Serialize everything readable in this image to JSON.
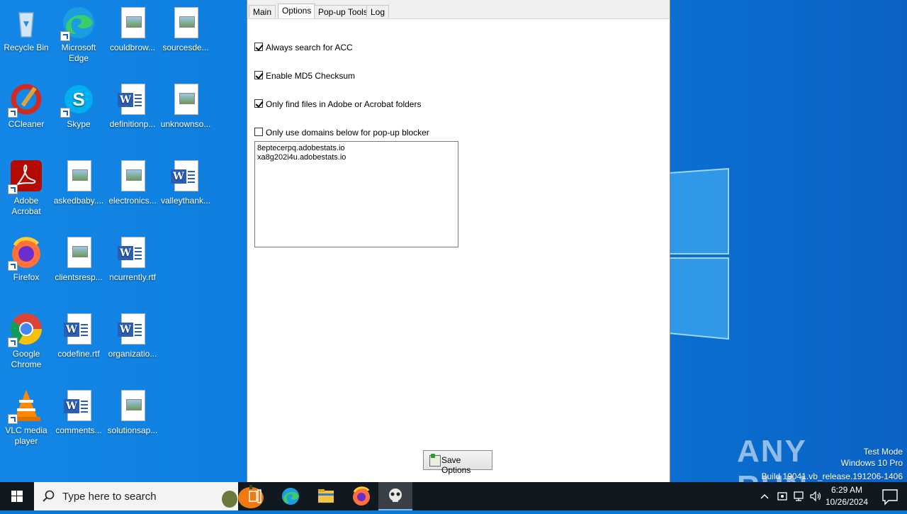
{
  "desktop": {
    "icons": [
      {
        "label": "Recycle Bin"
      },
      {
        "label": "Microsoft Edge"
      },
      {
        "label": "couldbrow..."
      },
      {
        "label": "sourcesde..."
      },
      {
        "label": "CCleaner"
      },
      {
        "label": "Skype"
      },
      {
        "label": "definitionp..."
      },
      {
        "label": "unknownso..."
      },
      {
        "label": "Adobe Acrobat"
      },
      {
        "label": "askedbaby...."
      },
      {
        "label": "electronics..."
      },
      {
        "label": "valleythank..."
      },
      {
        "label": "Firefox"
      },
      {
        "label": "clientsresp..."
      },
      {
        "label": "ncurrently.rtf"
      },
      {
        "label": "Google Chrome"
      },
      {
        "label": "codefine.rtf"
      },
      {
        "label": "organizatio..."
      },
      {
        "label": "VLC media player"
      },
      {
        "label": "comments..."
      },
      {
        "label": "solutionsap..."
      }
    ]
  },
  "app": {
    "tabs": [
      "Main",
      "Options",
      "Pop-up Tools",
      "Log"
    ],
    "active_tab": "Options",
    "options": [
      {
        "label": "Always search for ACC",
        "checked": true
      },
      {
        "label": "Enable MD5 Checksum",
        "checked": true
      },
      {
        "label": "Only find files in Adobe or Acrobat folders",
        "checked": true
      },
      {
        "label": "Only use domains below for pop-up blocker",
        "checked": false
      }
    ],
    "domains_text": "8eptecerpq.adobestats.io\nxa8g202i4u.adobestats.io",
    "save_button": "Save Options"
  },
  "watermark": {
    "logo": "ANY RUN",
    "line1": "Test Mode",
    "line2": "Windows 10 Pro",
    "line3": "Build 19041.vb_release.191206-1406"
  },
  "taskbar": {
    "search_placeholder": "Type here to search",
    "time": "6:29 AM",
    "date": "10/26/2024"
  },
  "colors": {
    "accent": "#0a78d6",
    "taskbar": "#101820"
  }
}
